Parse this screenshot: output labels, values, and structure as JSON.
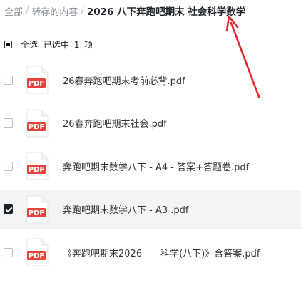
{
  "breadcrumb": {
    "items": [
      "全部",
      "转存的内容"
    ],
    "separator": "/",
    "current": "2026 八下奔跑吧期末 社会科学数学"
  },
  "selection": {
    "select_all_label": "全选",
    "selected_text": "已选中 1 项"
  },
  "files": [
    {
      "name": "26春奔跑吧期末考前必背.pdf",
      "checked": false,
      "icon_label": "PDF"
    },
    {
      "name": "26春奔跑吧期末社会.pdf",
      "checked": false,
      "icon_label": "PDF"
    },
    {
      "name": "奔跑吧期末数学八下 - A4 - 答案+答题卷.pdf",
      "checked": false,
      "icon_label": "PDF"
    },
    {
      "name": "奔跑吧期末数学八下 - A3 .pdf",
      "checked": true,
      "icon_label": "PDF"
    },
    {
      "name": "《奔跑吧期末2026——科学(八下)》含答案.pdf",
      "checked": false,
      "icon_label": "PDF"
    }
  ],
  "colors": {
    "pdf_red": "#e8433b",
    "selected_row_bg": "#f3f4f6",
    "arrow_red": "#e5262b"
  },
  "icons": {
    "file": "pdf-file-icon",
    "annotation": "red-arrow-annotation"
  }
}
